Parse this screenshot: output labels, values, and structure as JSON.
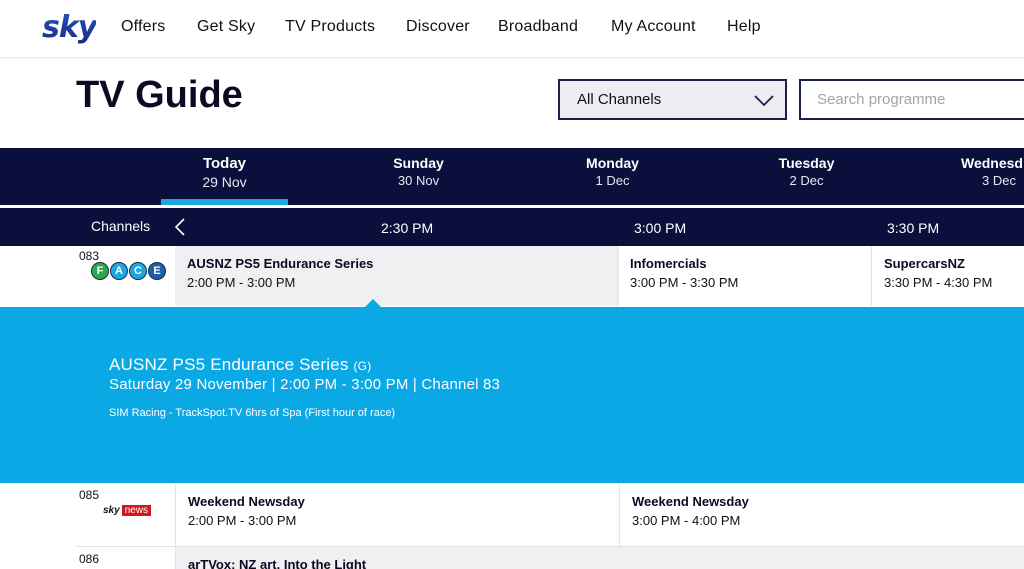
{
  "brand": {
    "logo_text": "sky",
    "logo_color": "#1d3b9a"
  },
  "nav": {
    "items": [
      {
        "label": "Offers"
      },
      {
        "label": "Get Sky"
      },
      {
        "label": "TV Products"
      },
      {
        "label": "Discover"
      },
      {
        "label": "Broadband"
      },
      {
        "label": "My Account"
      },
      {
        "label": "Help"
      }
    ]
  },
  "page": {
    "title": "TV Guide"
  },
  "filters": {
    "channel_select_value": "All Channels",
    "search_placeholder": "Search programme"
  },
  "days": [
    {
      "name": "Today",
      "date": "29 Nov",
      "active": true
    },
    {
      "name": "Sunday",
      "date": "30 Nov"
    },
    {
      "name": "Monday",
      "date": "1 Dec"
    },
    {
      "name": "Tuesday",
      "date": "2 Dec"
    },
    {
      "name": "Wednesd",
      "date": "3 Dec"
    }
  ],
  "timebar": {
    "channels_label": "Channels",
    "ticks": [
      "2:30 PM",
      "3:00 PM",
      "3:30 PM"
    ]
  },
  "channels": [
    {
      "number": "083",
      "logo_letters": [
        "F",
        "A",
        "C",
        "E"
      ],
      "logo_colors": [
        "#2aa84a",
        "#1ea6e0",
        "#1ea6e0",
        "#1d5fa8"
      ],
      "programmes": [
        {
          "title": "AUSNZ PS5 Endurance Series",
          "time": "2:00 PM - 3:00 PM",
          "selected": true
        },
        {
          "title": "Infomercials",
          "time": "3:00 PM - 3:30 PM"
        },
        {
          "title": "SupercarsNZ",
          "time": "3:30 PM - 4:30 PM"
        }
      ]
    },
    {
      "number": "085",
      "logo_text": "sky",
      "logo_badge": "news",
      "programmes": [
        {
          "title": "Weekend Newsday",
          "time": "2:00 PM - 3:00 PM"
        },
        {
          "title": "Weekend Newsday",
          "time": "3:00 PM - 4:00 PM"
        }
      ]
    },
    {
      "number": "086",
      "programmes": [
        {
          "title": "arTVox: NZ art, Into the Light"
        }
      ]
    }
  ],
  "detail": {
    "title": "AUSNZ PS5 Endurance Series",
    "rating": "(G)",
    "meta": "Saturday 29 November | 2:00 PM - 3:00 PM | Channel 83",
    "description": "SIM Racing - TrackSpot.TV 6hrs of Spa (First hour of race)",
    "bg_color": "#0aa9e6"
  },
  "colors": {
    "navy": "#0b0f3c",
    "accent": "#1ea6e0"
  }
}
